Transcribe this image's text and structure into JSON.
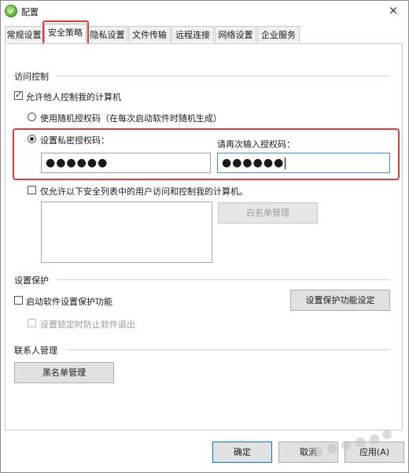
{
  "window": {
    "title": "配置",
    "close_glyph": "×"
  },
  "tabs": [
    {
      "label": "常规设置",
      "active": false
    },
    {
      "label": "安全策略",
      "active": true
    },
    {
      "label": "隐私设置",
      "active": false
    },
    {
      "label": "文件传输",
      "active": false
    },
    {
      "label": "远程连接",
      "active": false
    },
    {
      "label": "网络设置",
      "active": false
    },
    {
      "label": "企业服务",
      "active": false
    }
  ],
  "access_control": {
    "section_title": "访问控制",
    "allow_remote_control": {
      "label": "允许他人控制我的计算机",
      "checked": true
    },
    "random_code": {
      "label": "使用随机授权码（在每次启动软件时随机生成）",
      "selected": false
    },
    "private_code": {
      "label": "设置私密授权码：",
      "selected": true,
      "value": "●●●●●●"
    },
    "confirm_code": {
      "label": "请再次输入授权码：",
      "value": "●●●●●●"
    },
    "whitelist_only": {
      "label": "仅允许以下安全列表中的用户访问和控制我的计算机。",
      "checked": false
    },
    "whitelist_button": "白名单管理"
  },
  "settings_protection": {
    "section_title": "设置保护",
    "enable_protection": {
      "label": "启动软件设置保护功能",
      "checked": false
    },
    "protection_settings_button": "设置保护功能设定",
    "prevent_exit_on_lock": {
      "label": "设置锁定时防止软件退出",
      "checked": false
    }
  },
  "contacts": {
    "section_title": "联系人管理",
    "blacklist_button": "黑名单管理"
  },
  "footer": {
    "ok": "确定",
    "cancel": "取消",
    "apply": "应用(A)"
  },
  "colors": {
    "highlight_red": "#e23a3a",
    "focus_blue": "#3c8dd6",
    "app_icon_green": "#3d9b1f"
  }
}
